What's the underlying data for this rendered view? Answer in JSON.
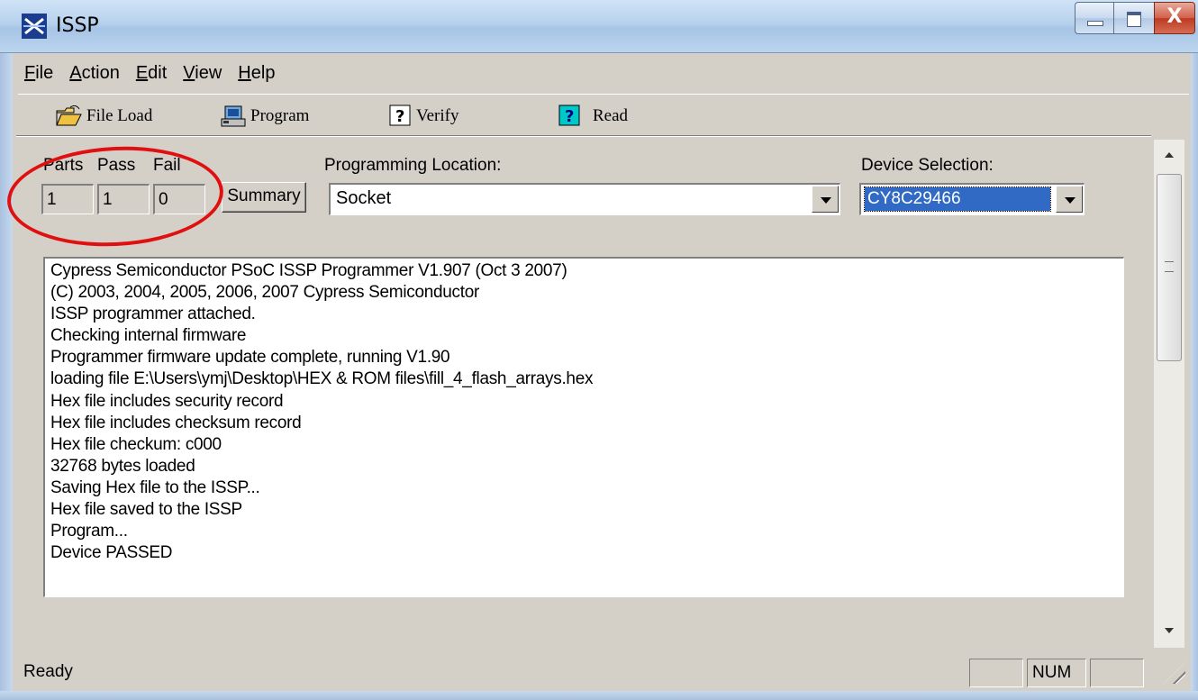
{
  "window": {
    "title": "ISSP",
    "min_label": "",
    "max_label": "",
    "close_label": "X"
  },
  "menu": [
    {
      "u": "F",
      "rest": "ile"
    },
    {
      "u": "A",
      "rest": "ction"
    },
    {
      "u": "E",
      "rest": "dit"
    },
    {
      "u": "V",
      "rest": "iew"
    },
    {
      "u": "H",
      "rest": "elp"
    }
  ],
  "toolbar": {
    "file_load": "File Load",
    "program": "Program",
    "verify": "Verify",
    "read": "Read"
  },
  "counters": {
    "parts_label": "Parts",
    "pass_label": "Pass",
    "fail_label": "Fail",
    "parts_value": "1",
    "pass_value": "1",
    "fail_value": "0",
    "summary_button": "Summary"
  },
  "programming_location": {
    "label": "Programming Location:",
    "value": "Socket"
  },
  "device_selection": {
    "label": "Device Selection:",
    "value": "CY8C29466"
  },
  "log": {
    "lines": [
      "Cypress Semiconductor PSoC ISSP Programmer V1.907 (Oct  3 2007)",
      "(C) 2003, 2004, 2005, 2006, 2007 Cypress Semiconductor",
      "ISSP programmer attached.",
      "Checking internal firmware",
      "Programmer firmware update complete, running V1.90",
      "loading file E:\\Users\\ymj\\Desktop\\HEX & ROM files\\fill_4_flash_arrays.hex",
      "Hex file includes security record",
      "Hex file includes checksum record",
      "Hex file checkum: c000",
      "32768 bytes loaded",
      "Saving Hex file to the ISSP...",
      "Hex file saved to the ISSP",
      "Program...",
      "Device PASSED"
    ]
  },
  "status": {
    "text": "Ready",
    "num": "NUM"
  },
  "colors": {
    "annotation_circle": "#e01010",
    "selection": "#316ac5"
  }
}
